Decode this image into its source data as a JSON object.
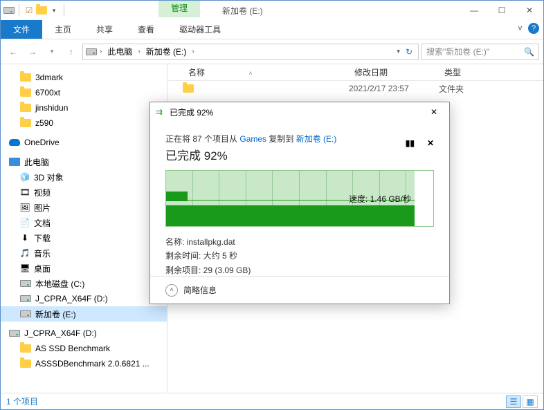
{
  "window": {
    "manage_tab": "管理",
    "title": "新加卷 (E:)"
  },
  "ribbon": {
    "file": "文件",
    "home": "主页",
    "share": "共享",
    "view": "查看",
    "drive_tools": "驱动器工具"
  },
  "address": {
    "root": "此电脑",
    "current": "新加卷 (E:)",
    "search_placeholder": "搜索\"新加卷 (E:)\""
  },
  "sidebar": {
    "quick": [
      "3dmark",
      "6700xt",
      "jinshidun",
      "z590"
    ],
    "onedrive": "OneDrive",
    "this_pc": "此电脑",
    "libs": [
      {
        "icon": "🧊",
        "label": "3D 对象"
      },
      {
        "icon": "🎞",
        "label": "视频"
      },
      {
        "icon": "🖼",
        "label": "图片"
      },
      {
        "icon": "📄",
        "label": "文档"
      },
      {
        "icon": "⬇",
        "label": "下载"
      },
      {
        "icon": "🎵",
        "label": "音乐"
      },
      {
        "icon": "🖥",
        "label": "桌面"
      }
    ],
    "drives": [
      "本地磁盘 (C:)",
      "J_CPRA_X64F (D:)",
      "新加卷 (E:)"
    ],
    "ext_drive": "J_CPRA_X64F (D:)",
    "ext_items": [
      "AS SSD Benchmark",
      "ASSSDBenchmark 2.0.6821 ..."
    ]
  },
  "columns": {
    "name": "名称",
    "date": "修改日期",
    "type": "类型"
  },
  "row": {
    "date": "2021/2/17 23:57",
    "type": "文件夹"
  },
  "status": {
    "count": "1 个项目"
  },
  "dialog": {
    "title": "已完成 92%",
    "copying_pre": "正在将 87 个项目从 ",
    "copying_src": "Games",
    "copying_mid": " 复制到 ",
    "copying_dst": "新加卷 (E:)",
    "percent": "已完成 92%",
    "speed": "速度: 1.46 GB/秒",
    "name_label": "名称: ",
    "name_val": "installpkg.dat",
    "time_label": "剩余时间: ",
    "time_val": "大约 5 秒",
    "items_label": "剩余项目: ",
    "items_val": "29 (3.09 GB)",
    "brief": "简略信息"
  }
}
